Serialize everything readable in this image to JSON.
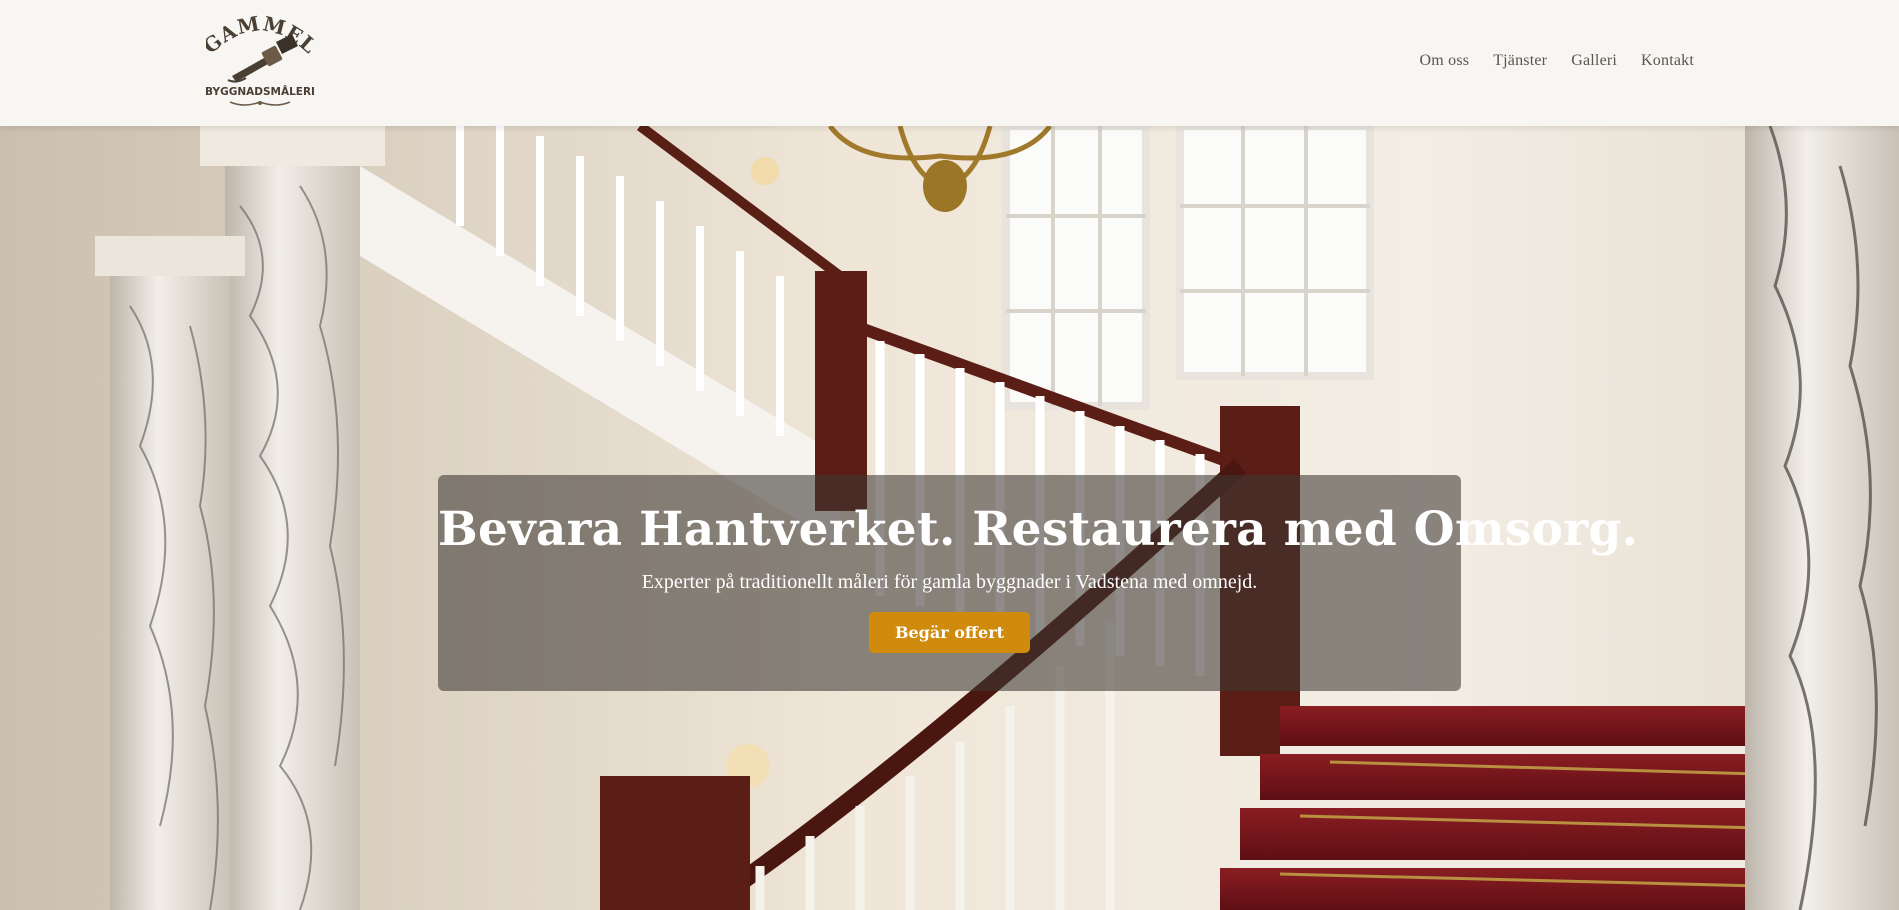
{
  "brand": {
    "logo_top": "GAMMEL",
    "logo_bottom": "BYGGNADSMÅLERI",
    "logo_icon": "paintbrush-icon"
  },
  "nav": {
    "items": [
      {
        "label": "Om oss"
      },
      {
        "label": "Tjänster"
      },
      {
        "label": "Galleri"
      },
      {
        "label": "Kontakt"
      }
    ]
  },
  "hero": {
    "title": "Bevara Hantverket. Restaurera med Omsorg.",
    "subtitle": "Experter på traditionellt måleri för gamla byggnader i Vadstena med omnejd.",
    "cta_label": "Begär offert",
    "image": "staircase-interior-photo"
  },
  "colors": {
    "header_bg": "#f7f6f3",
    "nav_text": "#5b544c",
    "accent": "#d08a0c",
    "overlay": "rgba(60,55,50,0.58)"
  }
}
